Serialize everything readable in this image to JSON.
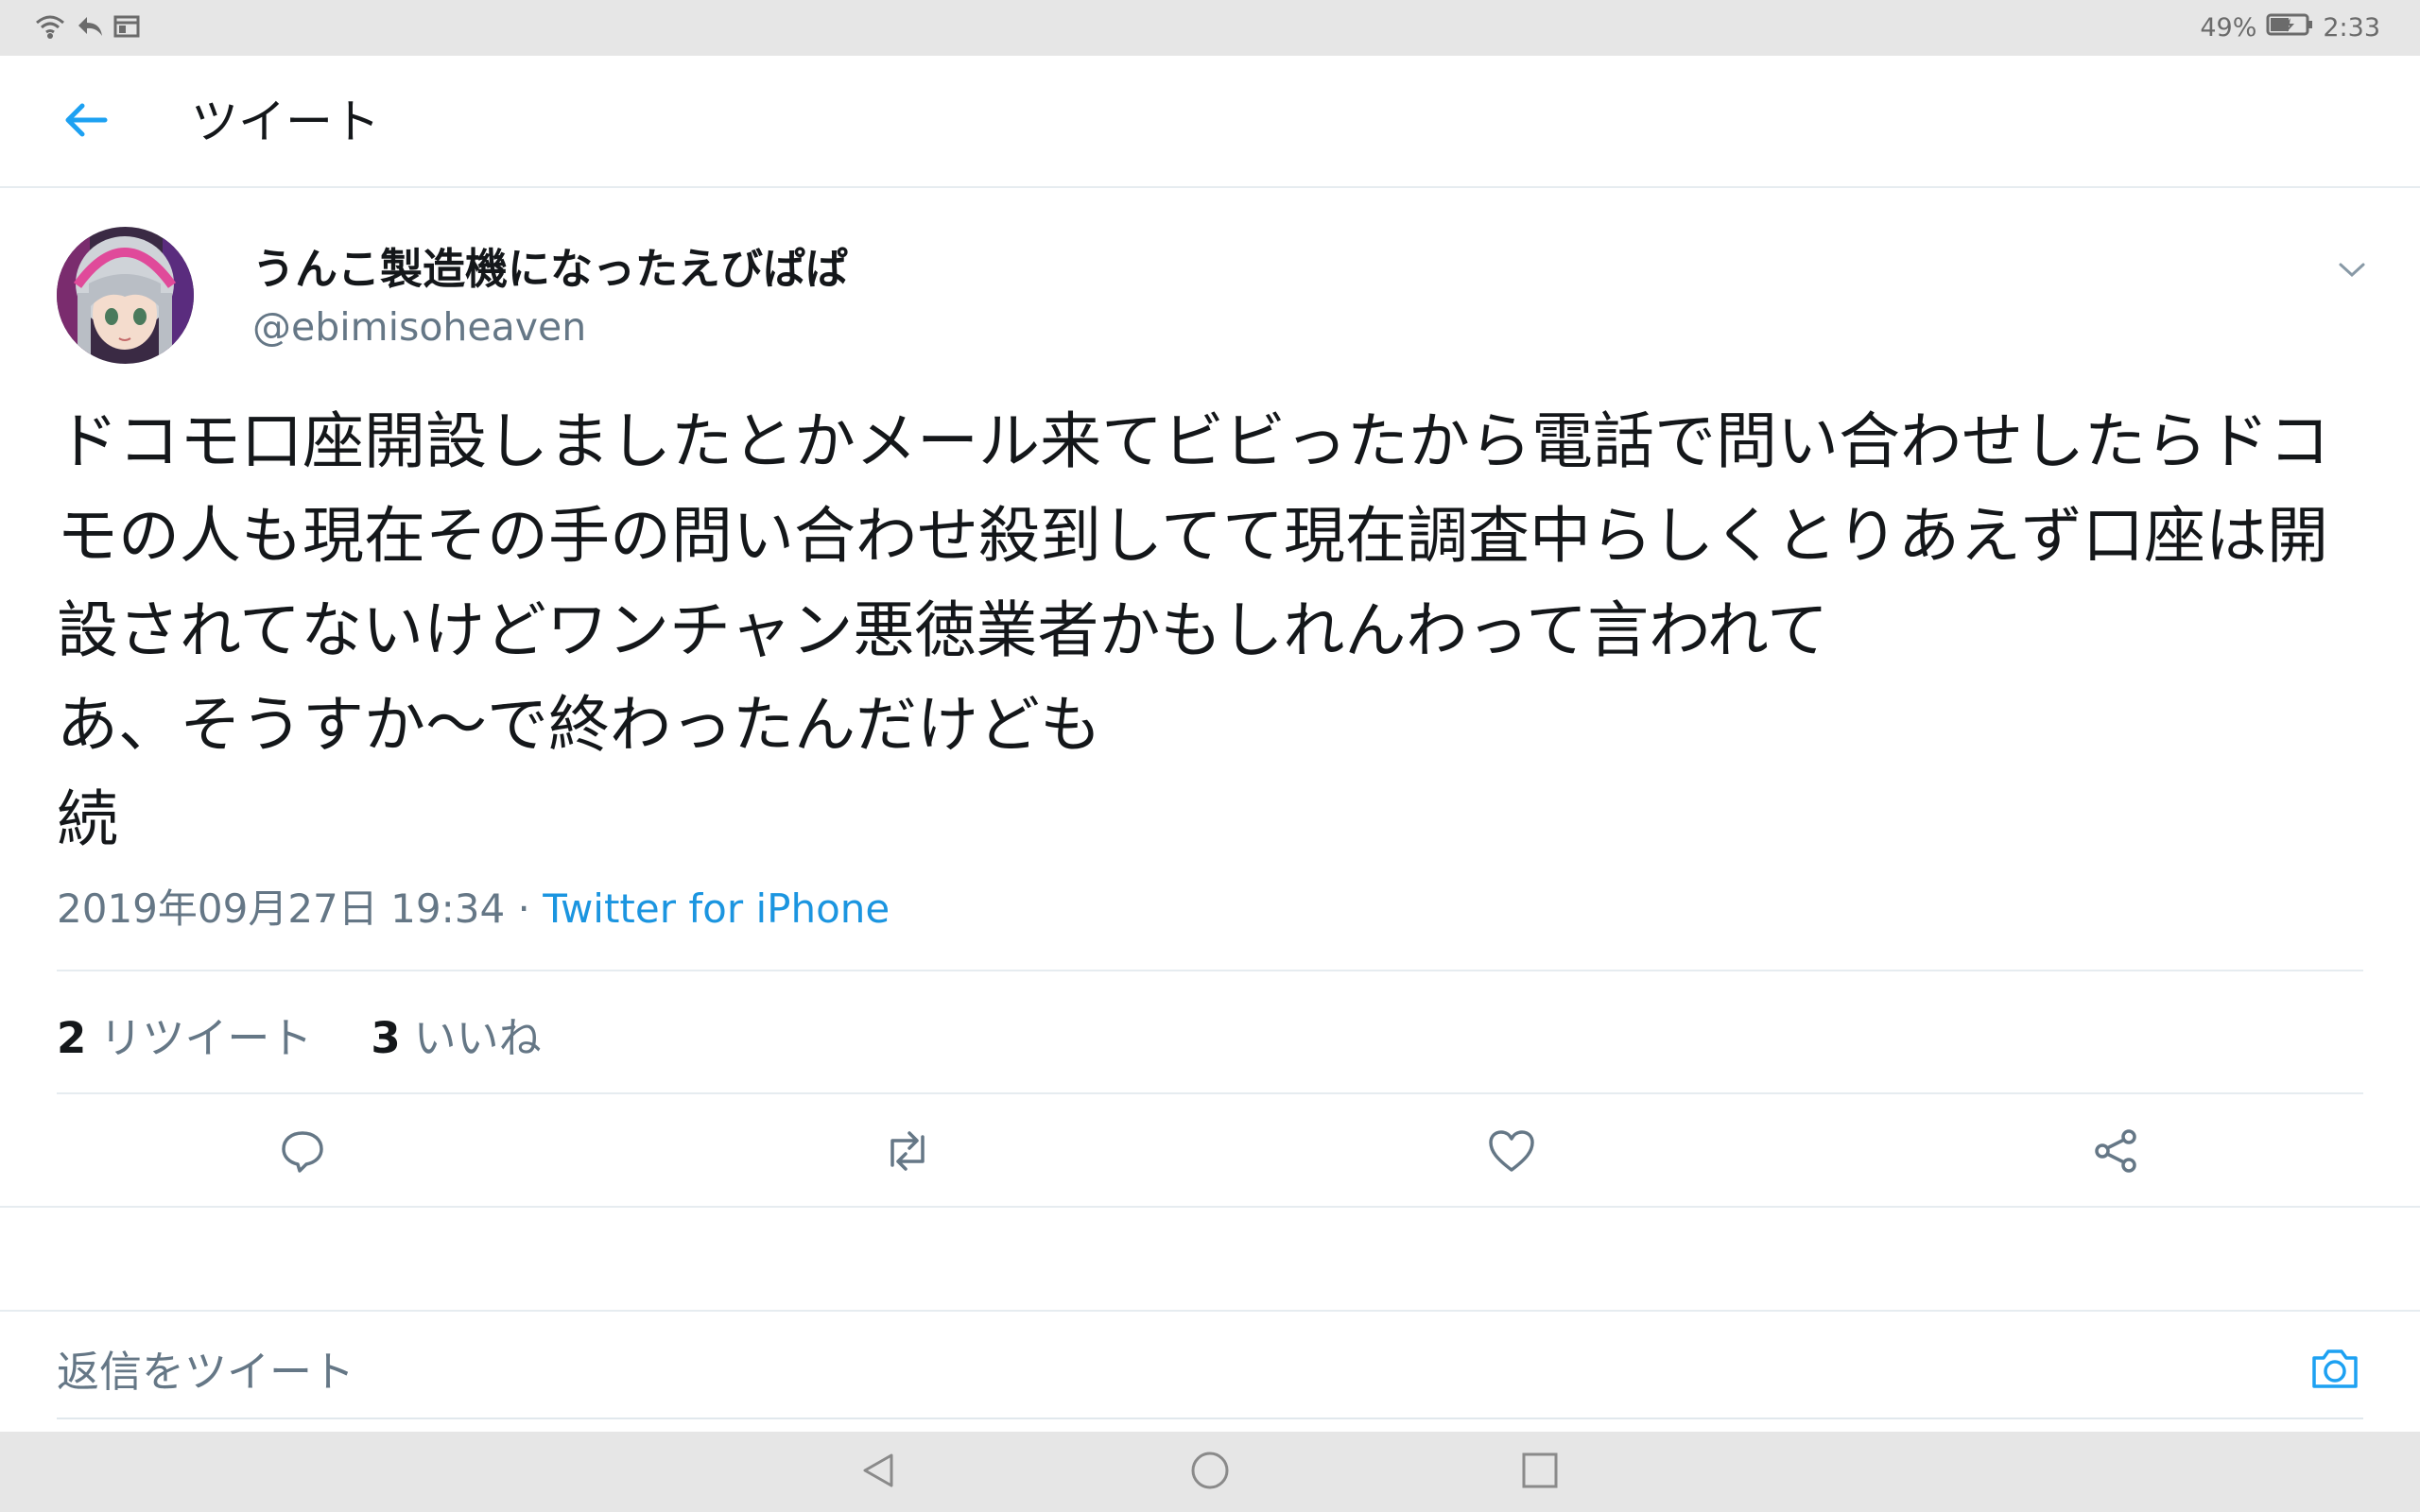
{
  "status_bar": {
    "battery": "49%",
    "time": "2:33",
    "icons": [
      "wifi-icon",
      "reply-arrow-icon",
      "window-icon",
      "battery-charging-icon"
    ]
  },
  "app_bar": {
    "title": "ツイート",
    "back_icon": "back-arrow-icon"
  },
  "tweet": {
    "display_name": "うんこ製造機になったえびぱぱ",
    "handle": "@ebimisoheaven",
    "text": "ドコモ口座開設しましたとかメール来てビビったから電話で問い合わせしたらドコ\nモの人も現在その手の問い合わせ殺到してて現在調査中らしくとりあえず口座は開\n設されてないけどワンチャン悪徳業者かもしれんわって言われて\nあ、そうすか〜で終わったんだけども\n続",
    "timestamp": "2019年09月27日 19:34",
    "separator": " · ",
    "source": "Twitter for iPhone",
    "retweet_count": "2",
    "retweet_label": "リツイート",
    "like_count": "3",
    "like_label": "いいね"
  },
  "actions": [
    "reply-icon",
    "retweet-icon",
    "like-heart-icon",
    "share-icon"
  ],
  "reply_box": {
    "placeholder": "返信をツイート",
    "value": ""
  },
  "colors": {
    "accent": "#1da1f2",
    "link": "#1b95e0",
    "secondary_text": "#657786",
    "primary_text": "#14171a",
    "divider": "#e6ecf0",
    "system_bar": "#e6e6e6"
  }
}
